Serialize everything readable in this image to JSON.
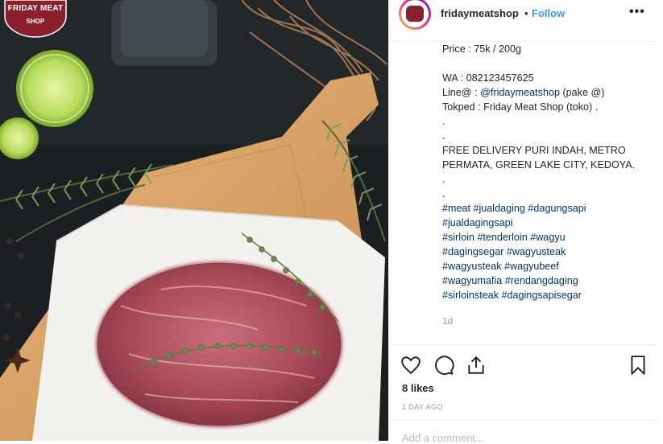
{
  "post": {
    "logo": {
      "line1": "FRIDAY MEAT",
      "line2": "SHOP"
    },
    "header": {
      "username": "fridaymeatshop",
      "separator": "•",
      "follow_label": "Follow",
      "more_label": "•••",
      "avatar_logo_text": "FRIDAY MEAT SHOP"
    },
    "caption": {
      "price": "Price : 75k / 200g",
      "wa": "WA : 082123457625",
      "line_prefix": "Line@ : ",
      "line_handle": "@fridaymeatshop",
      "line_suffix": " (pake @)",
      "tokped": "Tokped : Friday Meat Shop (toko) .",
      "dot1": ".",
      "dot2": ".",
      "delivery1": "FREE DELIVERY PURI INDAH, METRO",
      "delivery2": "PERMATA, GREEN LAKE CITY, KEDOYA.",
      "dot3": ".",
      "dot4": ".",
      "hashtag_lines": [
        "#meat #jualdaging #dagungsapi",
        "#jualdagingsapi",
        "#sirloin #tenderloin #wagyu",
        "#dagingsegar #wagyusteak",
        "#wagyusteak #wagyubeef",
        "#wagyumafia #rendangdaging",
        "#sirloinsteak #dagingsapisegar"
      ]
    },
    "relative_time": "1d",
    "likes": "8 likes",
    "date": "1 DAY AGO",
    "comment_placeholder": "Add a comment..."
  },
  "icons": [
    "heart-icon",
    "comment-icon",
    "share-icon",
    "bookmark-icon",
    "more-icon"
  ],
  "colors": {
    "link": "#003569",
    "follow": "#3897f0",
    "text": "#262626",
    "muted": "#999999",
    "brand": "#8b1f2b"
  }
}
